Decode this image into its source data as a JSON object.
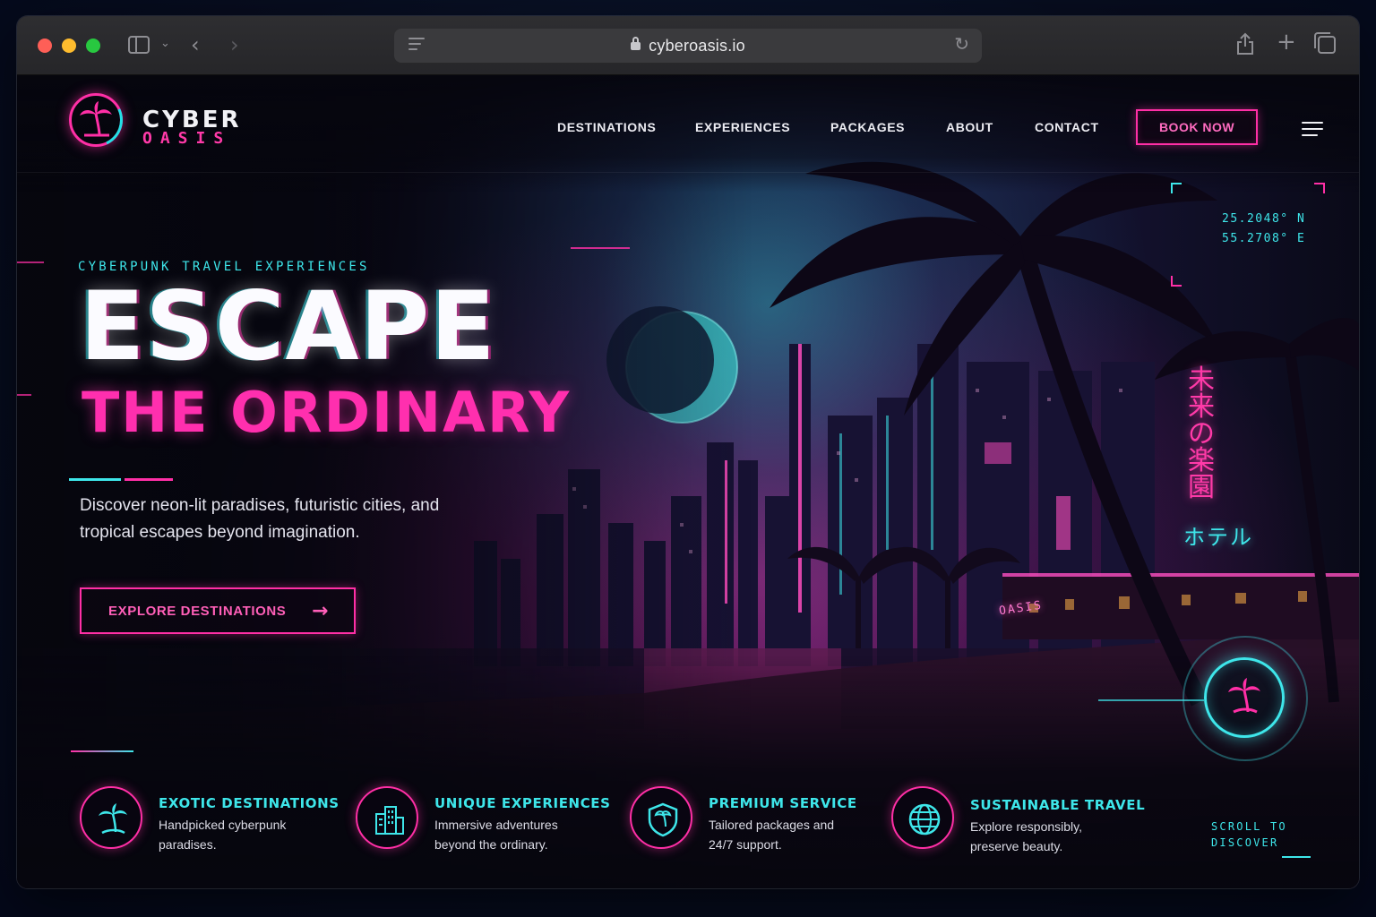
{
  "browser": {
    "url": "cyberoasis.io"
  },
  "brand": {
    "line1": "CYBER",
    "line2": "OASIS",
    "colors": {
      "pink": "#ff2fa6",
      "cyan": "#3ee6ea"
    }
  },
  "nav": {
    "items": [
      "DESTINATIONS",
      "EXPERIENCES",
      "PACKAGES",
      "ABOUT",
      "CONTACT"
    ],
    "cta": "BOOK NOW"
  },
  "hero": {
    "eyebrow": "CYBERPUNK TRAVEL EXPERIENCES",
    "headline_1": "ESCAPE",
    "headline_2": "THE ORDINARY",
    "lead": "Discover neon-lit paradises, futuristic cities, and tropical escapes beyond imagination.",
    "cta": "EXPLORE DESTINATIONS"
  },
  "hud": {
    "lat": "25.2048° N",
    "lon": "55.2708° E",
    "sign_vertical": "未来の楽園",
    "sign_hotel": "ホテル",
    "sign_oasis": "OASIS"
  },
  "features": [
    {
      "icon": "palm-tree-icon",
      "title": "EXOTIC DESTINATIONS",
      "desc_1": "Handpicked cyberpunk",
      "desc_2": "paradises."
    },
    {
      "icon": "buildings-icon",
      "title": "UNIQUE EXPERIENCES",
      "desc_1": "Immersive adventures",
      "desc_2": "beyond the ordinary."
    },
    {
      "icon": "shield-icon",
      "title": "PREMIUM SERVICE",
      "desc_1": "Tailored packages and",
      "desc_2": "24/7 support."
    },
    {
      "icon": "globe-icon",
      "title": "SUSTAINABLE TRAVEL",
      "desc_1": "Explore responsibly,",
      "desc_2": "preserve beauty."
    }
  ],
  "scroll": {
    "line1": "SCROLL TO",
    "line2": "DISCOVER"
  }
}
